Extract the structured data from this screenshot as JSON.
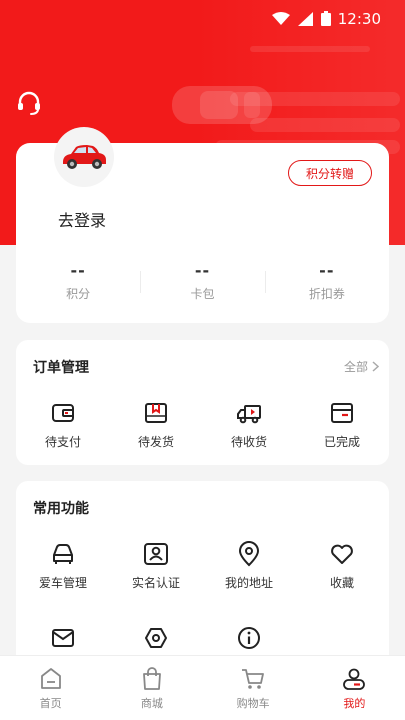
{
  "status_bar": {
    "time": "12:30"
  },
  "profile": {
    "login_label": "去登录",
    "transfer_button": "积分转赠",
    "stats": [
      {
        "value": "--",
        "label": "积分"
      },
      {
        "value": "--",
        "label": "卡包"
      },
      {
        "value": "--",
        "label": "折扣券"
      }
    ]
  },
  "orders": {
    "title": "订单管理",
    "more": "全部",
    "items": [
      {
        "label": "待支付",
        "icon": "wallet-icon"
      },
      {
        "label": "待发货",
        "icon": "package-icon"
      },
      {
        "label": "待收货",
        "icon": "truck-icon"
      },
      {
        "label": "已完成",
        "icon": "box-done-icon"
      }
    ]
  },
  "common": {
    "title": "常用功能",
    "items": [
      {
        "label": "爱车管理",
        "icon": "car-icon"
      },
      {
        "label": "实名认证",
        "icon": "id-card-icon"
      },
      {
        "label": "我的地址",
        "icon": "location-pin-icon"
      },
      {
        "label": "收藏",
        "icon": "heart-icon"
      },
      {
        "label": "",
        "icon": "mail-icon"
      },
      {
        "label": "",
        "icon": "hex-nut-icon"
      },
      {
        "label": "",
        "icon": "info-icon"
      }
    ]
  },
  "tabbar": {
    "tabs": [
      {
        "label": "首页",
        "icon": "home-icon"
      },
      {
        "label": "商城",
        "icon": "shopping-bag-icon"
      },
      {
        "label": "购物车",
        "icon": "cart-icon"
      },
      {
        "label": "我的",
        "icon": "profile-icon"
      }
    ],
    "active_tab": "我的"
  },
  "colors": {
    "brand": "#e21818",
    "hero": "#f21a1a"
  }
}
